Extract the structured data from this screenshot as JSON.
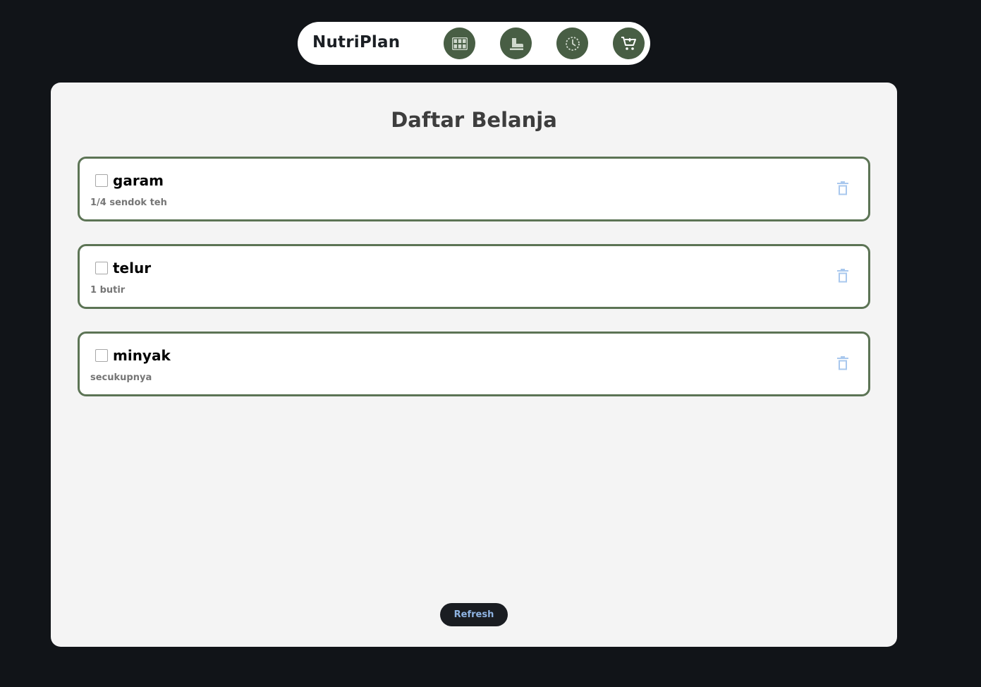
{
  "app": {
    "brand": "NutriPlan"
  },
  "nav": {
    "items": [
      {
        "icon": "grid-icon",
        "label": "meal-plan"
      },
      {
        "icon": "dining-icon",
        "label": "recipes"
      },
      {
        "icon": "history-icon",
        "label": "history"
      },
      {
        "icon": "cart-icon",
        "label": "shopping-list"
      }
    ],
    "accent_color": "#485e44"
  },
  "page": {
    "title": "Daftar Belanja",
    "refresh_label": "Refresh"
  },
  "shopping_list": [
    {
      "name": "garam",
      "quantity": "1/4 sendok teh",
      "checked": false
    },
    {
      "name": "telur",
      "quantity": "1 butir",
      "checked": false
    },
    {
      "name": "minyak",
      "quantity": "secukupnya",
      "checked": false
    }
  ],
  "colors": {
    "background": "#111418",
    "panel": "#f4f4f4",
    "item_border": "#5c7455",
    "delete_icon": "#a9c8ee",
    "refresh_text": "#8fb4e3"
  }
}
